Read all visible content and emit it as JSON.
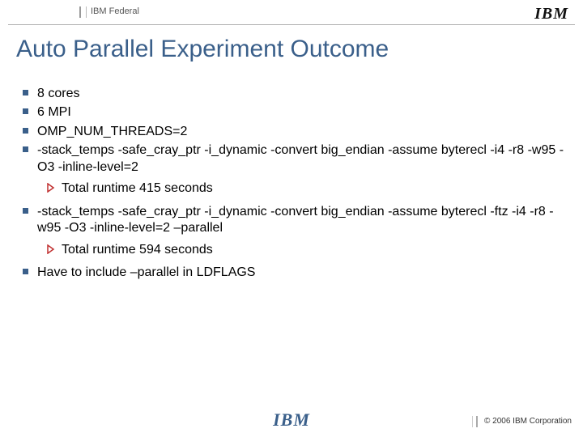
{
  "header": {
    "division": "IBM Federal",
    "logo": "IBM"
  },
  "title": "Auto Parallel Experiment Outcome",
  "bullets": [
    {
      "text": "8 cores"
    },
    {
      "text": "6 MPI"
    },
    {
      "text": "OMP_NUM_THREADS=2"
    },
    {
      "text": "-stack_temps -safe_cray_ptr -i_dynamic -convert big_endian -assume byterecl  -i4 -r8 -w95 -O3 -inline-level=2",
      "sub": [
        "Total runtime  415 seconds"
      ]
    },
    {
      "text": "-stack_temps -safe_cray_ptr -i_dynamic -convert big_endian -assume byterecl -ftz -i4 -r8 -w95 -O3 -inline-level=2 –parallel",
      "sub": [
        "Total runtime  594 seconds"
      ]
    },
    {
      "text": "Have to include –parallel in LDFLAGS"
    }
  ],
  "footer": {
    "logo": "IBM",
    "copyright": "© 2006 IBM Corporation"
  }
}
